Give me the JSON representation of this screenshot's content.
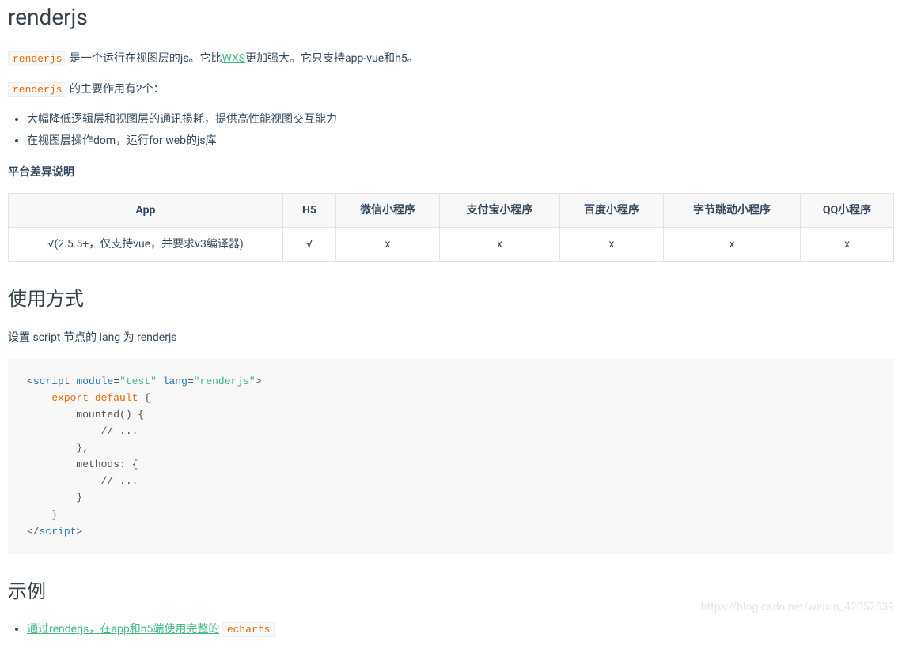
{
  "title": "renderjs",
  "intro": {
    "pre": "是一个运行在视图层的js。它比",
    "link": "WXS",
    "post": "更加强大。它只支持app-vue和h5。"
  },
  "purpose_lead": "的主要作用有2个：",
  "purposes": [
    "大幅降低逻辑层和视图层的通讯损耗，提供高性能视图交互能力",
    "在视图层操作dom，运行for web的js库"
  ],
  "platform_heading": "平台差异说明",
  "table": {
    "headers": [
      "App",
      "H5",
      "微信小程序",
      "支付宝小程序",
      "百度小程序",
      "字节跳动小程序",
      "QQ小程序"
    ],
    "rows": [
      [
        "√(2.5.5+，仅支持vue，并要求v3编译器)",
        "√",
        "x",
        "x",
        "x",
        "x",
        "x"
      ]
    ]
  },
  "usage_heading": "使用方式",
  "usage_desc": "设置 script 节点的 lang 为 renderjs",
  "code": {
    "open_lt": "<",
    "tag": "script",
    "attr_module": "module",
    "val_module": "\"test\"",
    "attr_lang": "lang",
    "val_lang": "\"renderjs\"",
    "open_gt": "=",
    "gt": ">",
    "line_export": "    export default {",
    "line_mounted": "        mounted() {",
    "line_comment1": "            // ...",
    "line_close1": "        },",
    "line_methods": "        methods: {",
    "line_comment2": "            // ...",
    "line_close2": "        }",
    "line_close3": "    }",
    "close_lt": "</",
    "close_tag": "script",
    "close_gt": ">",
    "kw_export": "export",
    "kw_default": "default"
  },
  "example_heading": "示例",
  "example": {
    "link_text": "通过renderjs，在app和h5端使用完整的",
    "code": "echarts"
  },
  "code_label": "renderjs",
  "watermark": "https://blog.csdn.net/weixin_42052539"
}
